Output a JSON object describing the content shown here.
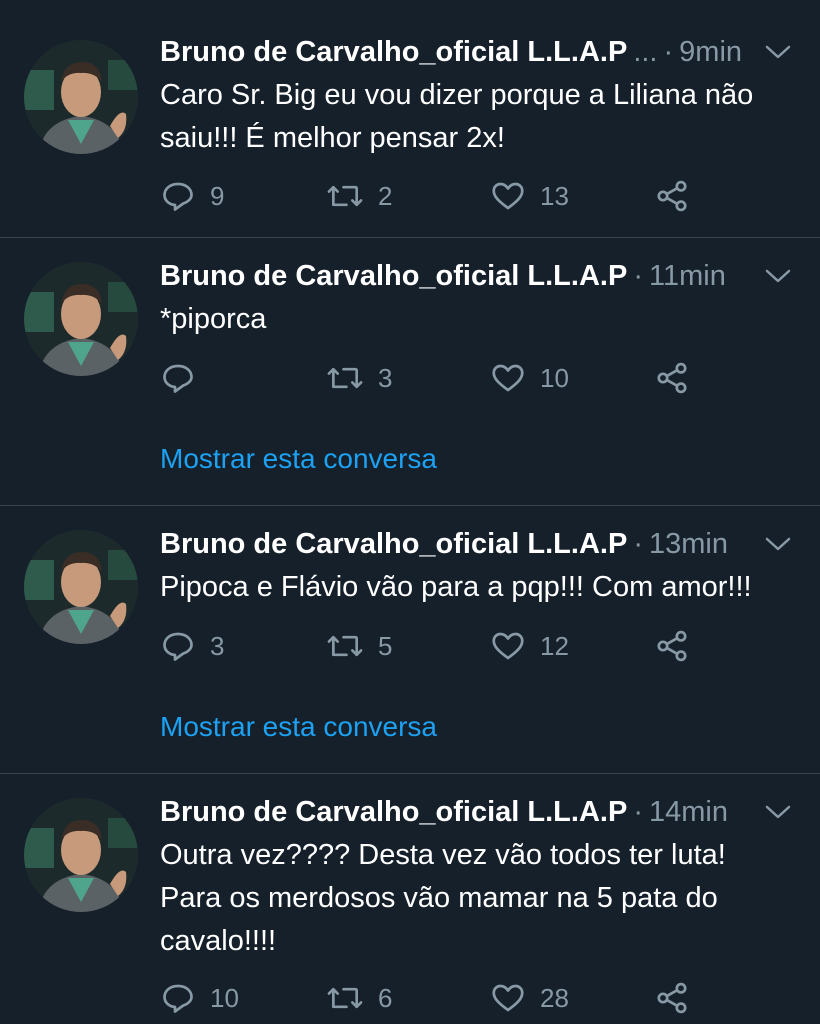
{
  "tweets": [
    {
      "author": "Bruno de Carvalho_oficial L.L.A.P",
      "ellipsis": "...",
      "dot": "·",
      "time": "9min",
      "lines": [
        "Caro Sr. Big eu vou dizer porque a Liliana não",
        "saiu!!! É melhor pensar 2x!"
      ],
      "replies": "9",
      "retweets": "2",
      "likes": "13",
      "show_convo": ""
    },
    {
      "author": "Bruno de Carvalho_oficial L.L.A.P",
      "dot": "·",
      "time": "11min",
      "lines": [
        "*piporca"
      ],
      "replies": "",
      "retweets": "3",
      "likes": "10",
      "show_convo": "Mostrar esta conversa"
    },
    {
      "author": "Bruno de Carvalho_oficial L.L.A.P",
      "dot": "·",
      "time": "13min",
      "lines": [
        "Pipoca e Flávio vão para a pqp!!! Com amor!!!"
      ],
      "replies": "3",
      "retweets": "5",
      "likes": "12",
      "show_convo": "Mostrar esta conversa"
    },
    {
      "author": "Bruno de Carvalho_oficial L.L.A.P",
      "dot": "·",
      "time": "14min",
      "lines": [
        "Outra vez???? Desta vez vão todos ter luta!",
        "Para os merdosos vão mamar na 5 pata do",
        "cavalo!!!!"
      ],
      "replies": "10",
      "retweets": "6",
      "likes": "28",
      "show_convo": ""
    }
  ],
  "icons": {
    "reply": "reply-icon",
    "retweet": "retweet-icon",
    "like": "heart-icon",
    "share": "share-icon",
    "caret": "chevron-down-icon"
  },
  "colors": {
    "background": "#15202b",
    "secondary_text": "#8899a6",
    "link": "#1da1f2",
    "divider": "#38444d"
  }
}
